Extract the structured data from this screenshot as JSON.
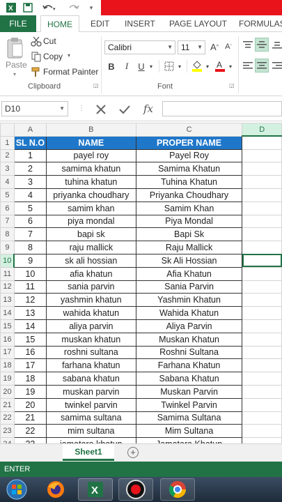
{
  "ribbon": {
    "tabs": [
      "FILE",
      "HOME",
      "EDIT",
      "INSERT",
      "PAGE LAYOUT",
      "FORMULAS"
    ],
    "active_tab": "HOME",
    "clipboard": {
      "paste": "Paste",
      "cut": "Cut",
      "copy": "Copy",
      "format_painter": "Format Painter",
      "group_label": "Clipboard"
    },
    "font": {
      "font_name": "Calibri",
      "font_size": "11",
      "group_label": "Font"
    }
  },
  "formula_bar": {
    "name_box": "D10",
    "fx": "fx",
    "value": ""
  },
  "columns": [
    "A",
    "B",
    "C",
    "D"
  ],
  "header_row": [
    "SL N.O",
    "NAME",
    "PROPER NAME"
  ],
  "rows": [
    [
      "1",
      "payel roy",
      "Payel Roy"
    ],
    [
      "2",
      "samima khatun",
      "Samima Khatun"
    ],
    [
      "3",
      "tuhina khatun",
      "Tuhina Khatun"
    ],
    [
      "4",
      "priyanka choudhary",
      "Priyanka Choudhary"
    ],
    [
      "5",
      "samim khan",
      "Samim Khan"
    ],
    [
      "6",
      "piya mondal",
      "Piya Mondal"
    ],
    [
      "7",
      "bapi sk",
      "Bapi Sk"
    ],
    [
      "8",
      "raju mallick",
      "Raju Mallick"
    ],
    [
      "9",
      "sk ali hossian",
      "Sk Ali Hossian"
    ],
    [
      "10",
      "afia khatun",
      "Afia Khatun"
    ],
    [
      "11",
      "sania parvin",
      "Sania Parvin"
    ],
    [
      "12",
      "yashmin khatun",
      "Yashmin Khatun"
    ],
    [
      "13",
      "wahida khatun",
      "Wahida Khatun"
    ],
    [
      "14",
      "aliya parvin",
      "Aliya Parvin"
    ],
    [
      "15",
      "muskan khatun",
      "Muskan Khatun"
    ],
    [
      "16",
      "roshni sultana",
      "Roshni Sultana"
    ],
    [
      "17",
      "farhana khatun",
      "Farhana Khatun"
    ],
    [
      "18",
      "sabana khatun",
      "Sabana Khatun"
    ],
    [
      "19",
      "muskan parvin",
      "Muskan Parvin"
    ],
    [
      "20",
      "twinkel parvin",
      "Twinkel Parvin"
    ],
    [
      "21",
      "samima sultana",
      "Samima Sultana"
    ],
    [
      "22",
      "mim sultana",
      "Mim Sultana"
    ],
    [
      "23",
      "jamatara khatun",
      "Jamatara Khatun"
    ]
  ],
  "selected_cell": "D10",
  "sheet_tab": "Sheet1",
  "status": "ENTER",
  "colors": {
    "excel_green": "#217346",
    "header_blue": "#1f77c9",
    "title_red": "#e8131b"
  },
  "taskbar": {
    "items": [
      "start-orb",
      "firefox",
      "excel",
      "recorder",
      "chrome"
    ]
  }
}
